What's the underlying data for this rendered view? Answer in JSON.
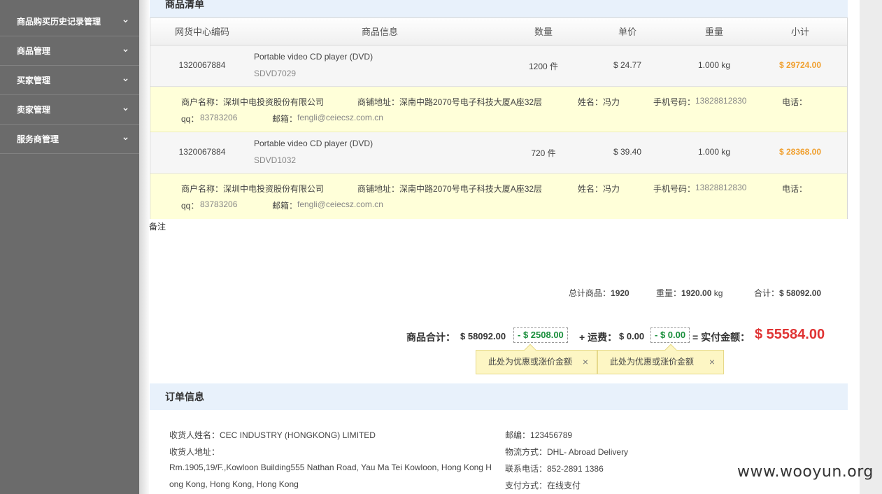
{
  "sidebar": {
    "items": [
      {
        "label": "商品购买历史记录管理"
      },
      {
        "label": "商品管理"
      },
      {
        "label": "买家管理"
      },
      {
        "label": "卖家管理"
      },
      {
        "label": "服务商管理"
      }
    ]
  },
  "goods_section": {
    "title": "商品清单"
  },
  "table": {
    "headers": [
      "网货中心编码",
      "商品信息",
      "数量",
      "单价",
      "重量",
      "小计"
    ],
    "rows": [
      {
        "code": "1320067884",
        "name": "Portable video CD player (DVD)",
        "sku": "SDVD7029",
        "qty": "1200 件",
        "price": "$ 24.77",
        "weight": "1.000 kg",
        "subtotal": "$ 29724.00",
        "seller": {
          "merchant": "商户名称：深圳中电投资股份有限公司",
          "address": "商铺地址：深南中路2070号电子科技大厦A座32层",
          "contact_name": "姓名：冯力",
          "mobile_label": "手机号码：",
          "mobile": "13828812830",
          "phone": "电话：",
          "qq_label": "qq：",
          "qq": "83783206",
          "email_label": "邮箱：",
          "email": "fengli@ceiecsz.com.cn"
        }
      },
      {
        "code": "1320067884",
        "name": "Portable video CD player (DVD)",
        "sku": "SDVD1032",
        "qty": "720 件",
        "price": "$ 39.40",
        "weight": "1.000 kg",
        "subtotal": "$ 28368.00",
        "seller": {
          "merchant": "商户名称：深圳中电投资股份有限公司",
          "address": "商铺地址：深南中路2070号电子科技大厦A座32层",
          "contact_name": "姓名：冯力",
          "mobile_label": "手机号码：",
          "mobile": "13828812830",
          "phone": "电话：",
          "qq_label": "qq：",
          "qq": "83783206",
          "email_label": "邮箱：",
          "email": "fengli@ceiecsz.com.cn"
        }
      }
    ]
  },
  "remark_label": "备注",
  "summary": {
    "total_items_label": "总计商品：",
    "total_items": "1920",
    "weight_label": "重量：",
    "weight_value": "1920.00",
    "weight_unit": "kg",
    "sum_label": "合计：",
    "sum_value": "$ 58092.00"
  },
  "totals": {
    "goods_total_label": "商品合计：",
    "goods_total": "$ 58092.00",
    "discount": "- $ 2508.00",
    "shipping_label": "+ 运费：",
    "shipping": "$ 0.00",
    "shipping_discount": "- $ 0.00",
    "payable_label": "= 实付金额：",
    "payable": "$ 55584.00",
    "tip_text": "此处为优惠或涨价金额",
    "close": "×"
  },
  "order_section": {
    "title": "订单信息"
  },
  "order": {
    "receiver_name_label": "收货人姓名：",
    "receiver_name": "CEC INDUSTRY (HONGKONG) LIMITED",
    "receiver_addr_label": "收货人地址：",
    "addr_line1": "Rm.1905,19/F.,Kowloon Building555 Nathan Road, Yau Ma Tei Kowloon, Hong Kong H",
    "addr_line2": "ong Kong, Hong Kong, Hong Kong",
    "zip_label": "邮编：",
    "zip": "123456789",
    "shipping_method_label": "物流方式：",
    "shipping_method": "DHL- Abroad Delivery",
    "phone_label": "联系电话：",
    "phone": "852-2891 1386",
    "payment_label": "支付方式：",
    "payment": "在线支付"
  },
  "watermark": "www.wooyun.org"
}
